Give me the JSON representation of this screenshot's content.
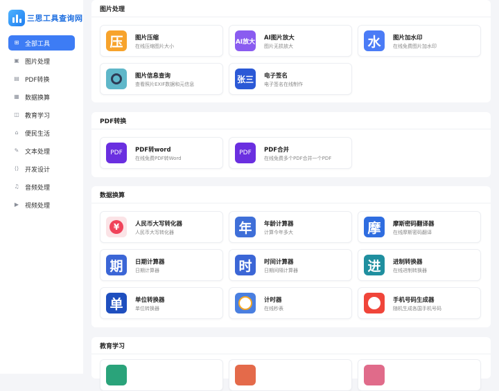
{
  "brand": {
    "name": "三思工具查询网"
  },
  "sidebar": {
    "items": [
      {
        "label": "全部工具",
        "icon": "grid-icon",
        "glyph": "⊞",
        "active": true
      },
      {
        "label": "图片处理",
        "icon": "image-icon",
        "glyph": "▣",
        "active": false
      },
      {
        "label": "PDF转换",
        "icon": "file-icon",
        "glyph": "▤",
        "active": false
      },
      {
        "label": "数据换算",
        "icon": "calculator-icon",
        "glyph": "▦",
        "active": false
      },
      {
        "label": "教育学习",
        "icon": "book-icon",
        "glyph": "◫",
        "active": false
      },
      {
        "label": "便民生活",
        "icon": "home-icon",
        "glyph": "⌂",
        "active": false
      },
      {
        "label": "文本处理",
        "icon": "edit-icon",
        "glyph": "✎",
        "active": false
      },
      {
        "label": "开发设计",
        "icon": "code-icon",
        "glyph": "⟨⟩",
        "active": false
      },
      {
        "label": "音频处理",
        "icon": "music-icon",
        "glyph": "♫",
        "active": false
      },
      {
        "label": "视频处理",
        "icon": "video-icon",
        "glyph": "▶",
        "active": false
      }
    ]
  },
  "sections": {
    "image": {
      "title": "图片处理",
      "cards": [
        {
          "title": "图片压缩",
          "desc": "在线压缩图片大小",
          "glyph": "压",
          "icon": "compress-icon",
          "color": "#f7a32c"
        },
        {
          "title": "AI图片放大",
          "desc": "图片无损放大",
          "glyph": "AI放大",
          "icon": "ai-upscale-icon",
          "color": "#8a5cf0"
        },
        {
          "title": "图片加水印",
          "desc": "在线免费图片加水印",
          "glyph": "水",
          "icon": "watermark-icon",
          "color": "#4b7cf6"
        },
        {
          "title": "图片信息查询",
          "desc": "查看照片EXIF数据和元信息",
          "glyph": "",
          "icon": "magnifier-icon",
          "color": "#5fb7c9"
        },
        {
          "title": "电子签名",
          "desc": "电子签名在线制作",
          "glyph": "张三",
          "icon": "signature-icon",
          "color": "#2b59d6"
        }
      ]
    },
    "pdf": {
      "title": "PDF转换",
      "cards": [
        {
          "title": "PDF转word",
          "desc": "在线免费PDF转Word",
          "glyph": "PDF",
          "icon": "pdf-icon",
          "color": "#6a2fe0"
        },
        {
          "title": "PDF合并",
          "desc": "在线免费多个PDF合并一个PDF",
          "glyph": "PDF",
          "icon": "pdf-merge-icon",
          "color": "#6a2fe0"
        }
      ]
    },
    "data": {
      "title": "数据换算",
      "cards": [
        {
          "title": "人民币大写转化器",
          "desc": "人民币大写转化器",
          "glyph": "¥",
          "icon": "yen-icon",
          "color": "#fbe3e6"
        },
        {
          "title": "年龄计算器",
          "desc": "计算今年多大",
          "glyph": "年",
          "icon": "age-icon",
          "color": "#3f6fd8"
        },
        {
          "title": "摩斯密码翻译器",
          "desc": "在线摩斯密码翻译",
          "glyph": "摩",
          "icon": "morse-icon",
          "color": "#2f6de0"
        },
        {
          "title": "日期计算器",
          "desc": "日期计算器",
          "glyph": "期",
          "icon": "date-icon",
          "color": "#3b66d6"
        },
        {
          "title": "时间计算器",
          "desc": "日期间隔计算器",
          "glyph": "时",
          "icon": "time-icon",
          "color": "#3b66d6"
        },
        {
          "title": "进制转换器",
          "desc": "在线进制转换器",
          "glyph": "进",
          "icon": "base-convert-icon",
          "color": "#1f8f9f"
        },
        {
          "title": "单位转换器",
          "desc": "单位转换器",
          "glyph": "单",
          "icon": "unit-icon",
          "color": "#1f4fbf"
        },
        {
          "title": "计时器",
          "desc": "在线秒表",
          "glyph": "",
          "icon": "stopwatch-icon",
          "color": "#4a7fe0"
        },
        {
          "title": "手机号码生成器",
          "desc": "随机生成各国手机号码",
          "glyph": "",
          "icon": "phone-icon",
          "color": "#f0453a"
        }
      ]
    },
    "edu": {
      "title": "教育学习"
    }
  }
}
